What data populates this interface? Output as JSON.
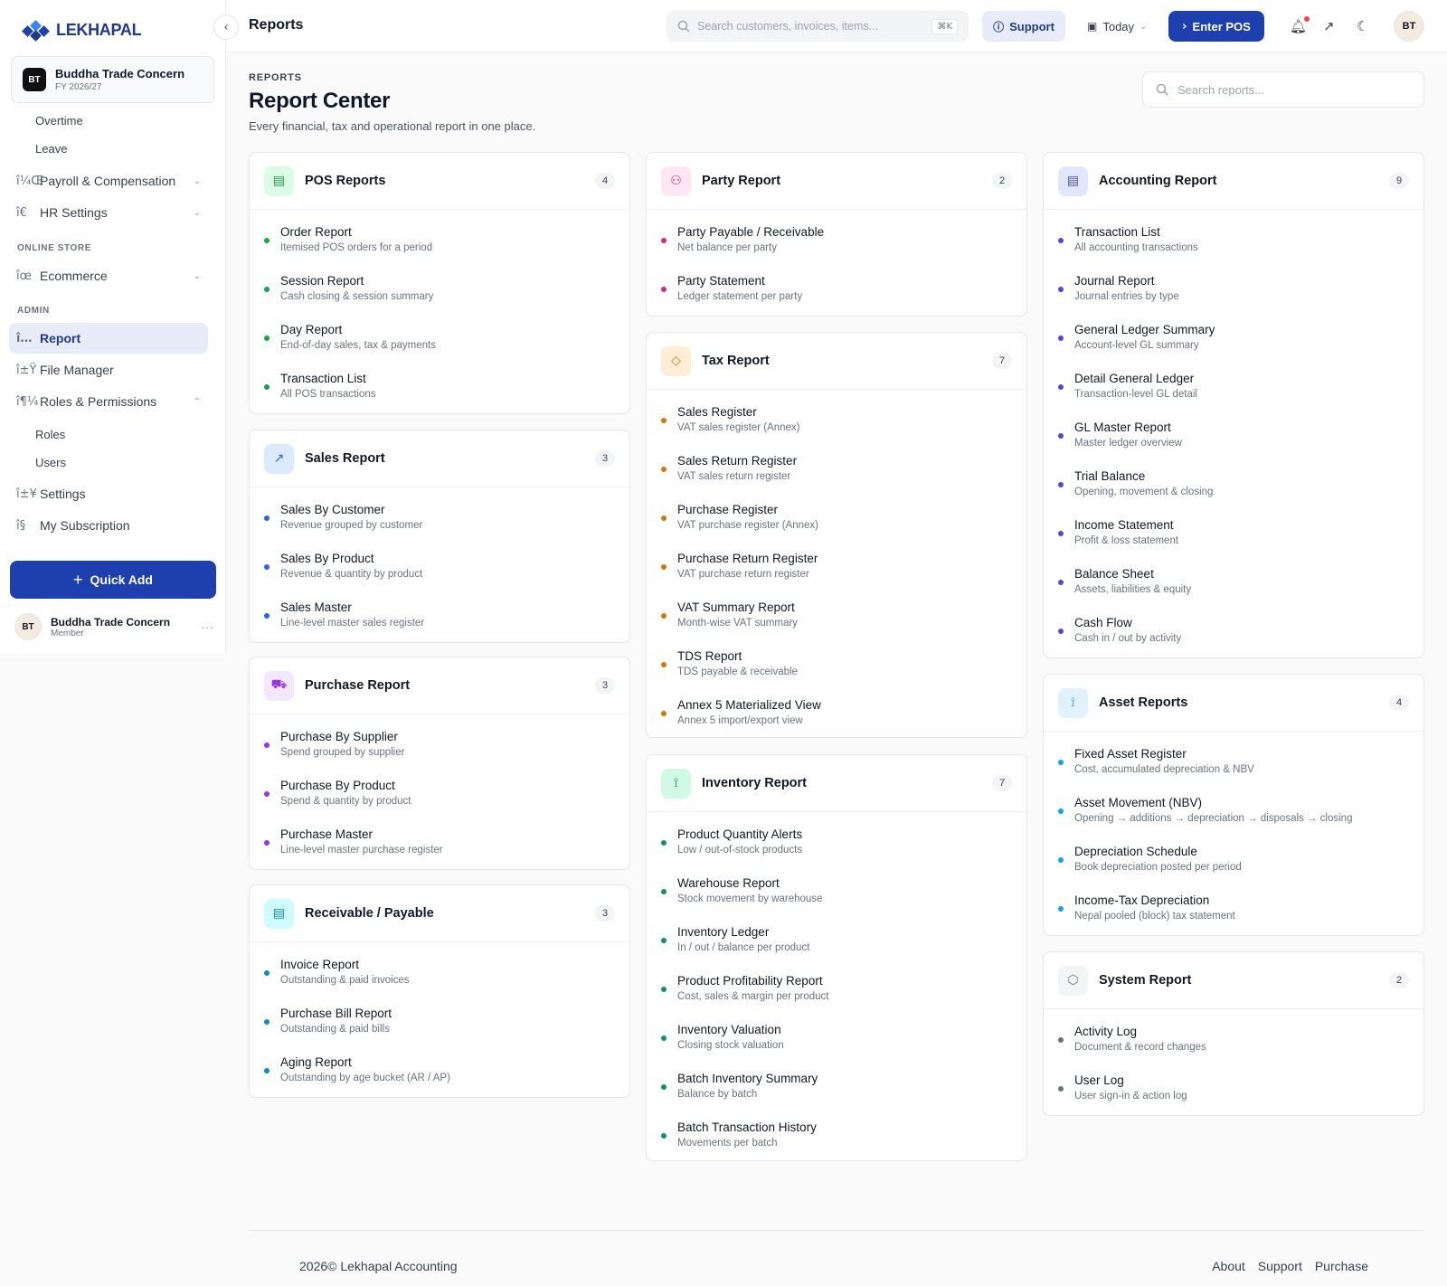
{
  "app": {
    "logo_text": "LEKHAPAL"
  },
  "org": {
    "initials": "BT",
    "name": "Buddha Trade Concern",
    "fy": "FY 2026/27"
  },
  "sidebar": {
    "sub_top": [
      "Overtime",
      "Leave"
    ],
    "items": [
      {
        "label": "Payroll & Compensation",
        "icon": "î¼Œ"
      },
      {
        "label": "HR Settings",
        "icon": "î€"
      },
      {
        "label": "Ecommerce",
        "icon": "îœ"
      },
      {
        "label": "Report",
        "icon": "î…"
      },
      {
        "label": "File Manager",
        "icon": "î±Ÿ"
      },
      {
        "label": "Roles & Permissions",
        "icon": "î¶¼"
      },
      {
        "label": "Settings",
        "icon": "î±¥"
      },
      {
        "label": "My Subscription",
        "icon": "î§"
      }
    ],
    "sections": [
      "ONLINE STORE",
      "ADMIN"
    ],
    "sub_roles": [
      "Roles",
      "Users"
    ],
    "quick_add": "Quick Add",
    "user": {
      "initials": "BT",
      "name": "Buddha Trade Concern",
      "role": "Member"
    }
  },
  "topbar": {
    "page_name": "Reports",
    "search_placeholder": "Search customers, invoices, items...",
    "shortcut": "⌘K",
    "support": "Support",
    "date_range": "Today",
    "enter_pos": "Enter POS",
    "avatar": "BT"
  },
  "header": {
    "eyebrow": "REPORTS",
    "title": "Report Center",
    "subtitle": "Every financial, tax and operational report in one place.",
    "search_placeholder": "Search reports..."
  },
  "cards": {
    "pos": {
      "title": "POS Reports",
      "count": "4",
      "items": [
        {
          "t": "Order Report",
          "d": "Itemised POS orders for a period"
        },
        {
          "t": "Session Report",
          "d": "Cash closing & session summary"
        },
        {
          "t": "Day Report",
          "d": "End-of-day sales, tax & payments"
        },
        {
          "t": "Transaction List",
          "d": "All POS transactions"
        }
      ]
    },
    "sales": {
      "title": "Sales Report",
      "count": "3",
      "items": [
        {
          "t": "Sales By Customer",
          "d": "Revenue grouped by customer"
        },
        {
          "t": "Sales By Product",
          "d": "Revenue & quantity by product"
        },
        {
          "t": "Sales Master",
          "d": "Line-level master sales register"
        }
      ]
    },
    "purchase": {
      "title": "Purchase Report",
      "count": "3",
      "items": [
        {
          "t": "Purchase By Supplier",
          "d": "Spend grouped by supplier"
        },
        {
          "t": "Purchase By Product",
          "d": "Spend & quantity by product"
        },
        {
          "t": "Purchase Master",
          "d": "Line-level master purchase register"
        }
      ]
    },
    "recv": {
      "title": "Receivable / Payable",
      "count": "3",
      "items": [
        {
          "t": "Invoice Report",
          "d": "Outstanding & paid invoices"
        },
        {
          "t": "Purchase Bill Report",
          "d": "Outstanding & paid bills"
        },
        {
          "t": "Aging Report",
          "d": "Outstanding by age bucket (AR / AP)"
        }
      ]
    },
    "party": {
      "title": "Party Report",
      "count": "2",
      "items": [
        {
          "t": "Party Payable / Receivable",
          "d": "Net balance per party"
        },
        {
          "t": "Party Statement",
          "d": "Ledger statement per party"
        }
      ]
    },
    "tax": {
      "title": "Tax Report",
      "count": "7",
      "items": [
        {
          "t": "Sales Register",
          "d": "VAT sales register (Annex)"
        },
        {
          "t": "Sales Return Register",
          "d": "VAT sales return register"
        },
        {
          "t": "Purchase Register",
          "d": "VAT purchase register (Annex)"
        },
        {
          "t": "Purchase Return Register",
          "d": "VAT purchase return register"
        },
        {
          "t": "VAT Summary Report",
          "d": "Month-wise VAT summary"
        },
        {
          "t": "TDS Report",
          "d": "TDS payable & receivable"
        },
        {
          "t": "Annex 5 Materialized View",
          "d": "Annex 5 import/export view"
        }
      ]
    },
    "inventory": {
      "title": "Inventory Report",
      "count": "7",
      "items": [
        {
          "t": "Product Quantity Alerts",
          "d": "Low / out-of-stock products"
        },
        {
          "t": "Warehouse Report",
          "d": "Stock movement by warehouse"
        },
        {
          "t": "Inventory Ledger",
          "d": "In / out / balance per product"
        },
        {
          "t": "Product Profitability Report",
          "d": "Cost, sales & margin per product"
        },
        {
          "t": "Inventory Valuation",
          "d": "Closing stock valuation"
        },
        {
          "t": "Batch Inventory Summary",
          "d": "Balance by batch"
        },
        {
          "t": "Batch Transaction History",
          "d": "Movements per batch"
        }
      ]
    },
    "accounting": {
      "title": "Accounting Report",
      "count": "9",
      "items": [
        {
          "t": "Transaction List",
          "d": "All accounting transactions"
        },
        {
          "t": "Journal Report",
          "d": "Journal entries by type"
        },
        {
          "t": "General Ledger Summary",
          "d": "Account-level GL summary"
        },
        {
          "t": "Detail General Ledger",
          "d": "Transaction-level GL detail"
        },
        {
          "t": "GL Master Report",
          "d": "Master ledger overview"
        },
        {
          "t": "Trial Balance",
          "d": "Opening, movement & closing"
        },
        {
          "t": "Income Statement",
          "d": "Profit & loss statement"
        },
        {
          "t": "Balance Sheet",
          "d": "Assets, liabilities & equity"
        },
        {
          "t": "Cash Flow",
          "d": "Cash in / out by activity"
        }
      ]
    },
    "asset": {
      "title": "Asset Reports",
      "count": "4",
      "items": [
        {
          "t": "Fixed Asset Register",
          "d": "Cost, accumulated depreciation & NBV"
        },
        {
          "t": "Asset Movement (NBV)",
          "d": "Opening → additions → depreciation → disposals → closing"
        },
        {
          "t": "Depreciation Schedule",
          "d": "Book depreciation posted per period"
        },
        {
          "t": "Income-Tax Depreciation",
          "d": "Nepal pooled (block) tax statement"
        }
      ]
    },
    "system": {
      "title": "System Report",
      "count": "2",
      "items": [
        {
          "t": "Activity Log",
          "d": "Document & record changes"
        },
        {
          "t": "User Log",
          "d": "User sign-in & action log"
        }
      ]
    }
  },
  "colors": {
    "brand": "#1e40af",
    "pos": "#16a34a",
    "sales": "#2563eb",
    "purchase": "#9333ea",
    "recv": "#0891b2",
    "party": "#db2777",
    "tax": "#d97706",
    "inventory": "#059669",
    "accounting": "#4f46e5",
    "asset": "#0ea5e9",
    "system": "#6b7280"
  },
  "footer": {
    "copyright": "2026© Lekhapal Accounting",
    "links": [
      "About",
      "Support",
      "Purchase"
    ]
  }
}
